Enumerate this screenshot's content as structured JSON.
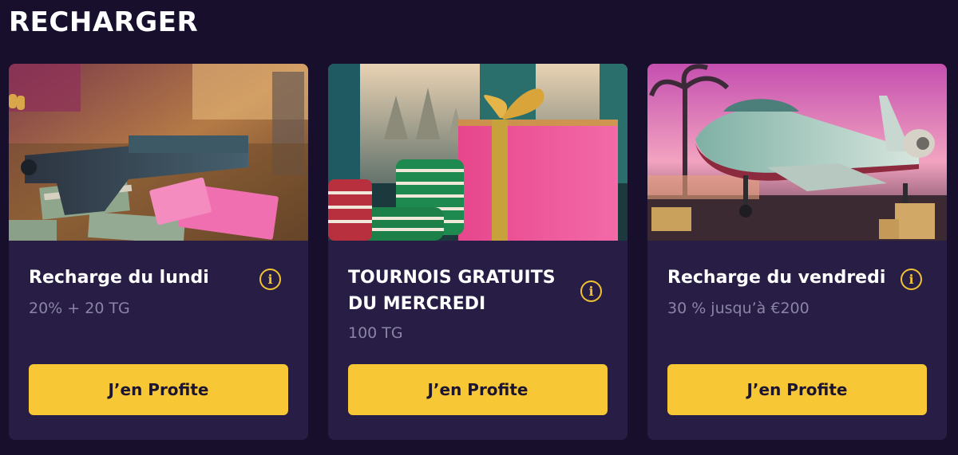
{
  "section": {
    "title": "RECHARGER"
  },
  "cards": [
    {
      "title": "Recharge du lundi",
      "subtitle": "20% + 20 TG",
      "button_label": "J’en Profite",
      "info_icon": "info-icon"
    },
    {
      "title": "TOURNOIS GRATUITS DU MERCREDI",
      "subtitle": "100 TG",
      "button_label": "J’en Profite",
      "info_icon": "info-icon"
    },
    {
      "title": "Recharge du vendredi",
      "subtitle": "30 % jusqu’à €200",
      "button_label": "J’en Profite",
      "info_icon": "info-icon"
    }
  ],
  "colors": {
    "page_background": "#170f2c",
    "card_background": "#281e45",
    "accent_yellow": "#f8c736",
    "subtitle_gray": "#8a84a6"
  }
}
